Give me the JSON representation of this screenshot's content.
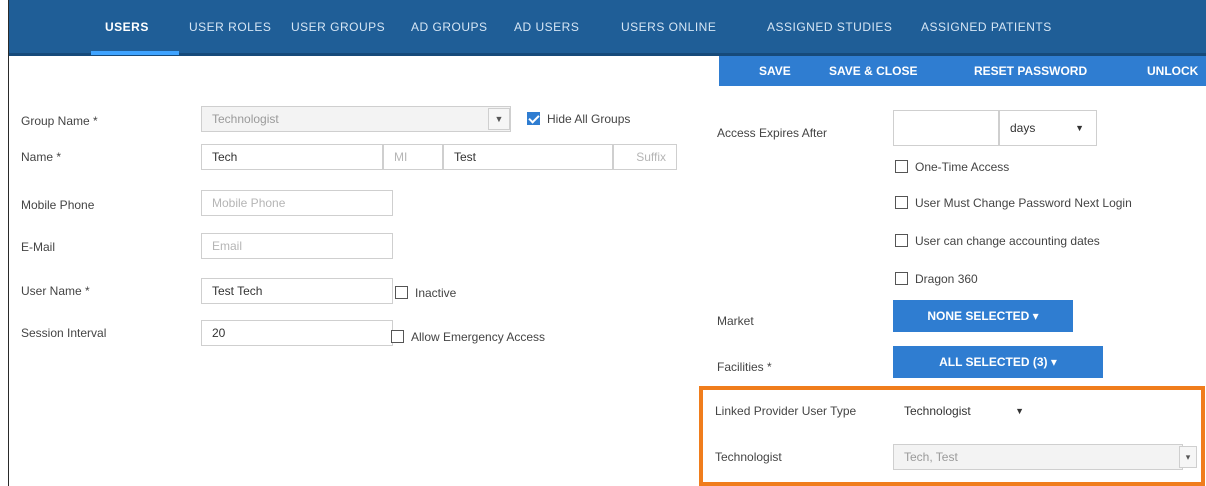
{
  "tabs": [
    {
      "label": "Users"
    },
    {
      "label": "User Roles"
    },
    {
      "label": "User Groups"
    },
    {
      "label": "AD Groups"
    },
    {
      "label": "AD Users"
    },
    {
      "label": "Users Online"
    },
    {
      "label": "Assigned Studies"
    },
    {
      "label": "Assigned Patients"
    }
  ],
  "actions": {
    "save": "SAVE",
    "save_close": "SAVE & CLOSE",
    "reset_password": "RESET PASSWORD",
    "unlock": "UNLOCK"
  },
  "form_left": {
    "group_name": {
      "label": "Group Name *",
      "value": "Technologist"
    },
    "hide_all_groups": {
      "label": "Hide All Groups",
      "checked": true
    },
    "name": {
      "label": "Name *",
      "first": "Tech",
      "mi_placeholder": "MI",
      "last": "Test",
      "suffix_placeholder": "Suffix"
    },
    "mobile_phone": {
      "label": "Mobile Phone",
      "placeholder": "Mobile Phone"
    },
    "email": {
      "label": "E-Mail",
      "placeholder": "Email"
    },
    "user_name": {
      "label": "User Name *",
      "value": "Test Tech"
    },
    "inactive": {
      "label": "Inactive",
      "checked": false
    },
    "session_interval": {
      "label": "Session Interval",
      "value": "20"
    },
    "allow_emergency": {
      "label": "Allow Emergency Access",
      "checked": false
    }
  },
  "form_right": {
    "access_expires": {
      "label": "Access Expires After",
      "value": "",
      "unit": "days"
    },
    "one_time_access": {
      "label": "One-Time Access",
      "checked": false
    },
    "must_change_password": {
      "label": "User Must Change Password Next Login",
      "checked": false
    },
    "change_accounting": {
      "label": "User can change accounting dates",
      "checked": false
    },
    "dragon360": {
      "label": "Dragon 360",
      "checked": false
    },
    "market": {
      "label": "Market",
      "button": "NONE SELECTED ▾"
    },
    "facilities": {
      "label": "Facilities *",
      "button": "ALL SELECTED (3) ▾"
    },
    "linked_provider_type": {
      "label": "Linked Provider User Type",
      "value": "Technologist"
    },
    "technologist": {
      "label": "Technologist",
      "value": "Tech, Test"
    }
  },
  "colors": {
    "nav": "#1f5e97",
    "accent": "#2f7dd1",
    "highlight": "#f07d1c"
  }
}
